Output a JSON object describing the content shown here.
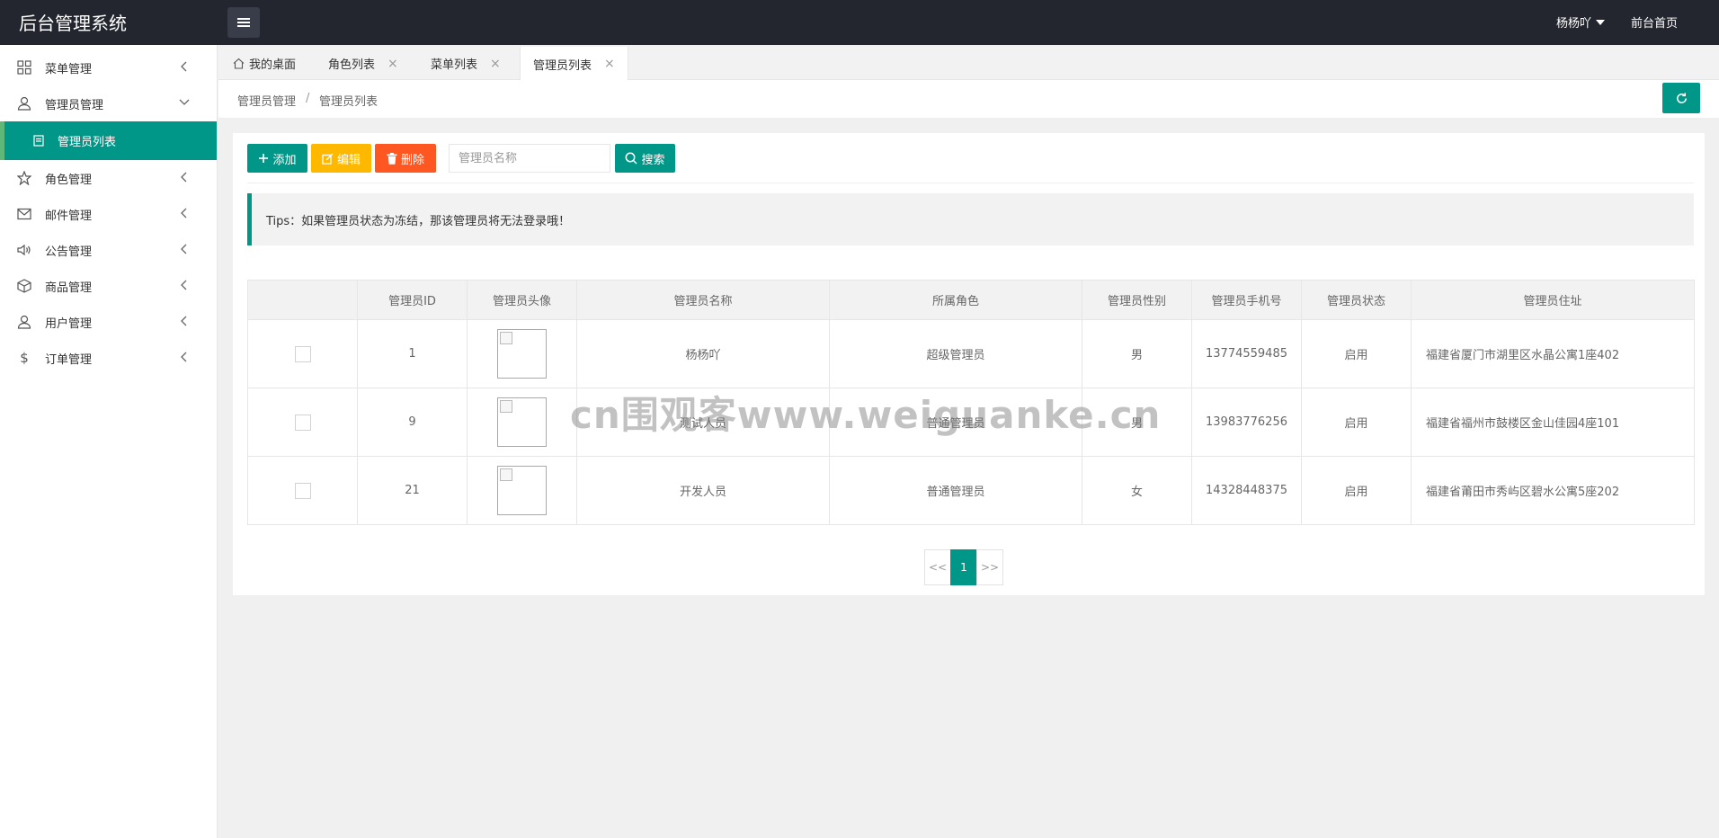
{
  "app": {
    "title": "后台管理系统"
  },
  "header": {
    "user_name": "杨杨吖",
    "front_link": "前台首页"
  },
  "sidebar": {
    "items": [
      {
        "label": "菜单管理"
      },
      {
        "label": "管理员管理"
      },
      {
        "label": "管理员列表"
      },
      {
        "label": "角色管理"
      },
      {
        "label": "邮件管理"
      },
      {
        "label": "公告管理"
      },
      {
        "label": "商品管理"
      },
      {
        "label": "用户管理"
      },
      {
        "label": "订单管理"
      }
    ]
  },
  "tabs": [
    {
      "label": "我的桌面"
    },
    {
      "label": "角色列表"
    },
    {
      "label": "菜单列表"
    },
    {
      "label": "管理员列表"
    }
  ],
  "breadcrumb": {
    "parent": "管理员管理",
    "separator": "/",
    "current": "管理员列表"
  },
  "toolbar": {
    "add_label": "添加",
    "edit_label": "编辑",
    "delete_label": "删除",
    "search_placeholder": "管理员名称",
    "search_label": "搜索"
  },
  "tips": "Tips：如果管理员状态为冻结，那该管理员将无法登录哦！",
  "table": {
    "headers": [
      "",
      "管理员ID",
      "管理员头像",
      "管理员名称",
      "所属角色",
      "管理员性别",
      "管理员手机号",
      "管理员状态",
      "管理员住址"
    ],
    "rows": [
      {
        "id": "1",
        "name": "杨杨吖",
        "role": "超级管理员",
        "gender": "男",
        "phone": "13774559485",
        "status": "启用",
        "address": "福建省厦门市湖里区水晶公寓1座402"
      },
      {
        "id": "9",
        "name": "测试人员",
        "role": "普通管理员",
        "gender": "男",
        "phone": "13983776256",
        "status": "启用",
        "address": "福建省福州市鼓楼区金山佳园4座101"
      },
      {
        "id": "21",
        "name": "开发人员",
        "role": "普通管理员",
        "gender": "女",
        "phone": "14328448375",
        "status": "启用",
        "address": "福建省莆田市秀屿区碧水公寓5座202"
      }
    ]
  },
  "pagination": {
    "prev": "<<",
    "current": "1",
    "next": ">>"
  },
  "watermark": "cn围观客www.weiguanke.cn",
  "colors": {
    "accent": "#009688",
    "header": "#23262e",
    "warning": "#ffb800",
    "danger": "#ff5722"
  }
}
